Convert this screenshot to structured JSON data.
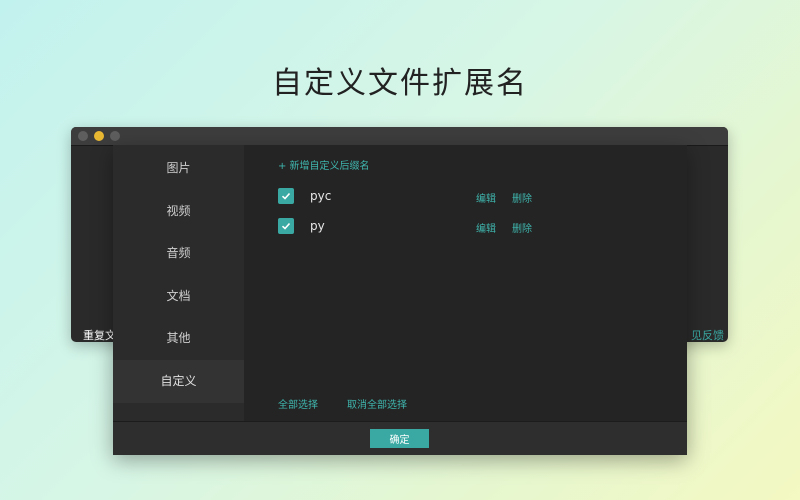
{
  "headline": "自定义文件扩展名",
  "back_window": {
    "left_text": "重复文",
    "right_text": "见反馈"
  },
  "sidebar": {
    "items": [
      {
        "label": "图片"
      },
      {
        "label": "视频"
      },
      {
        "label": "音频"
      },
      {
        "label": "文档"
      },
      {
        "label": "其他"
      },
      {
        "label": "自定义"
      }
    ],
    "active": "自定义"
  },
  "content": {
    "add_label": "+ 新增自定义后缀名",
    "extensions": [
      {
        "name": "pyc",
        "checked": true,
        "edit_label": "编辑",
        "delete_label": "删除"
      },
      {
        "name": "py",
        "checked": true,
        "edit_label": "编辑",
        "delete_label": "删除"
      }
    ],
    "select_all_label": "全部选择",
    "deselect_all_label": "取消全部选择"
  },
  "footer": {
    "ok_label": "确定"
  },
  "colors": {
    "accent": "#3aa9a3",
    "minimize": "#e9b833"
  }
}
